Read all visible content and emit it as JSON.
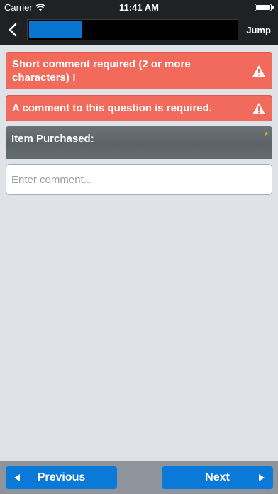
{
  "status_bar": {
    "carrier": "Carrier",
    "time": "11:41 AM"
  },
  "nav": {
    "jump_label": "Jump"
  },
  "alerts": [
    {
      "text": "Short comment required (2 or more characters) !"
    },
    {
      "text": "A comment to this question is required."
    }
  ],
  "question": {
    "label": "Item Purchased:",
    "required_marker": "*"
  },
  "comment": {
    "value": "",
    "placeholder": "Enter comment..."
  },
  "footer": {
    "previous_label": "Previous",
    "next_label": "Next"
  },
  "colors": {
    "accent": "#0a79d8",
    "alert": "#f26a5b",
    "required": "#f5a623"
  }
}
